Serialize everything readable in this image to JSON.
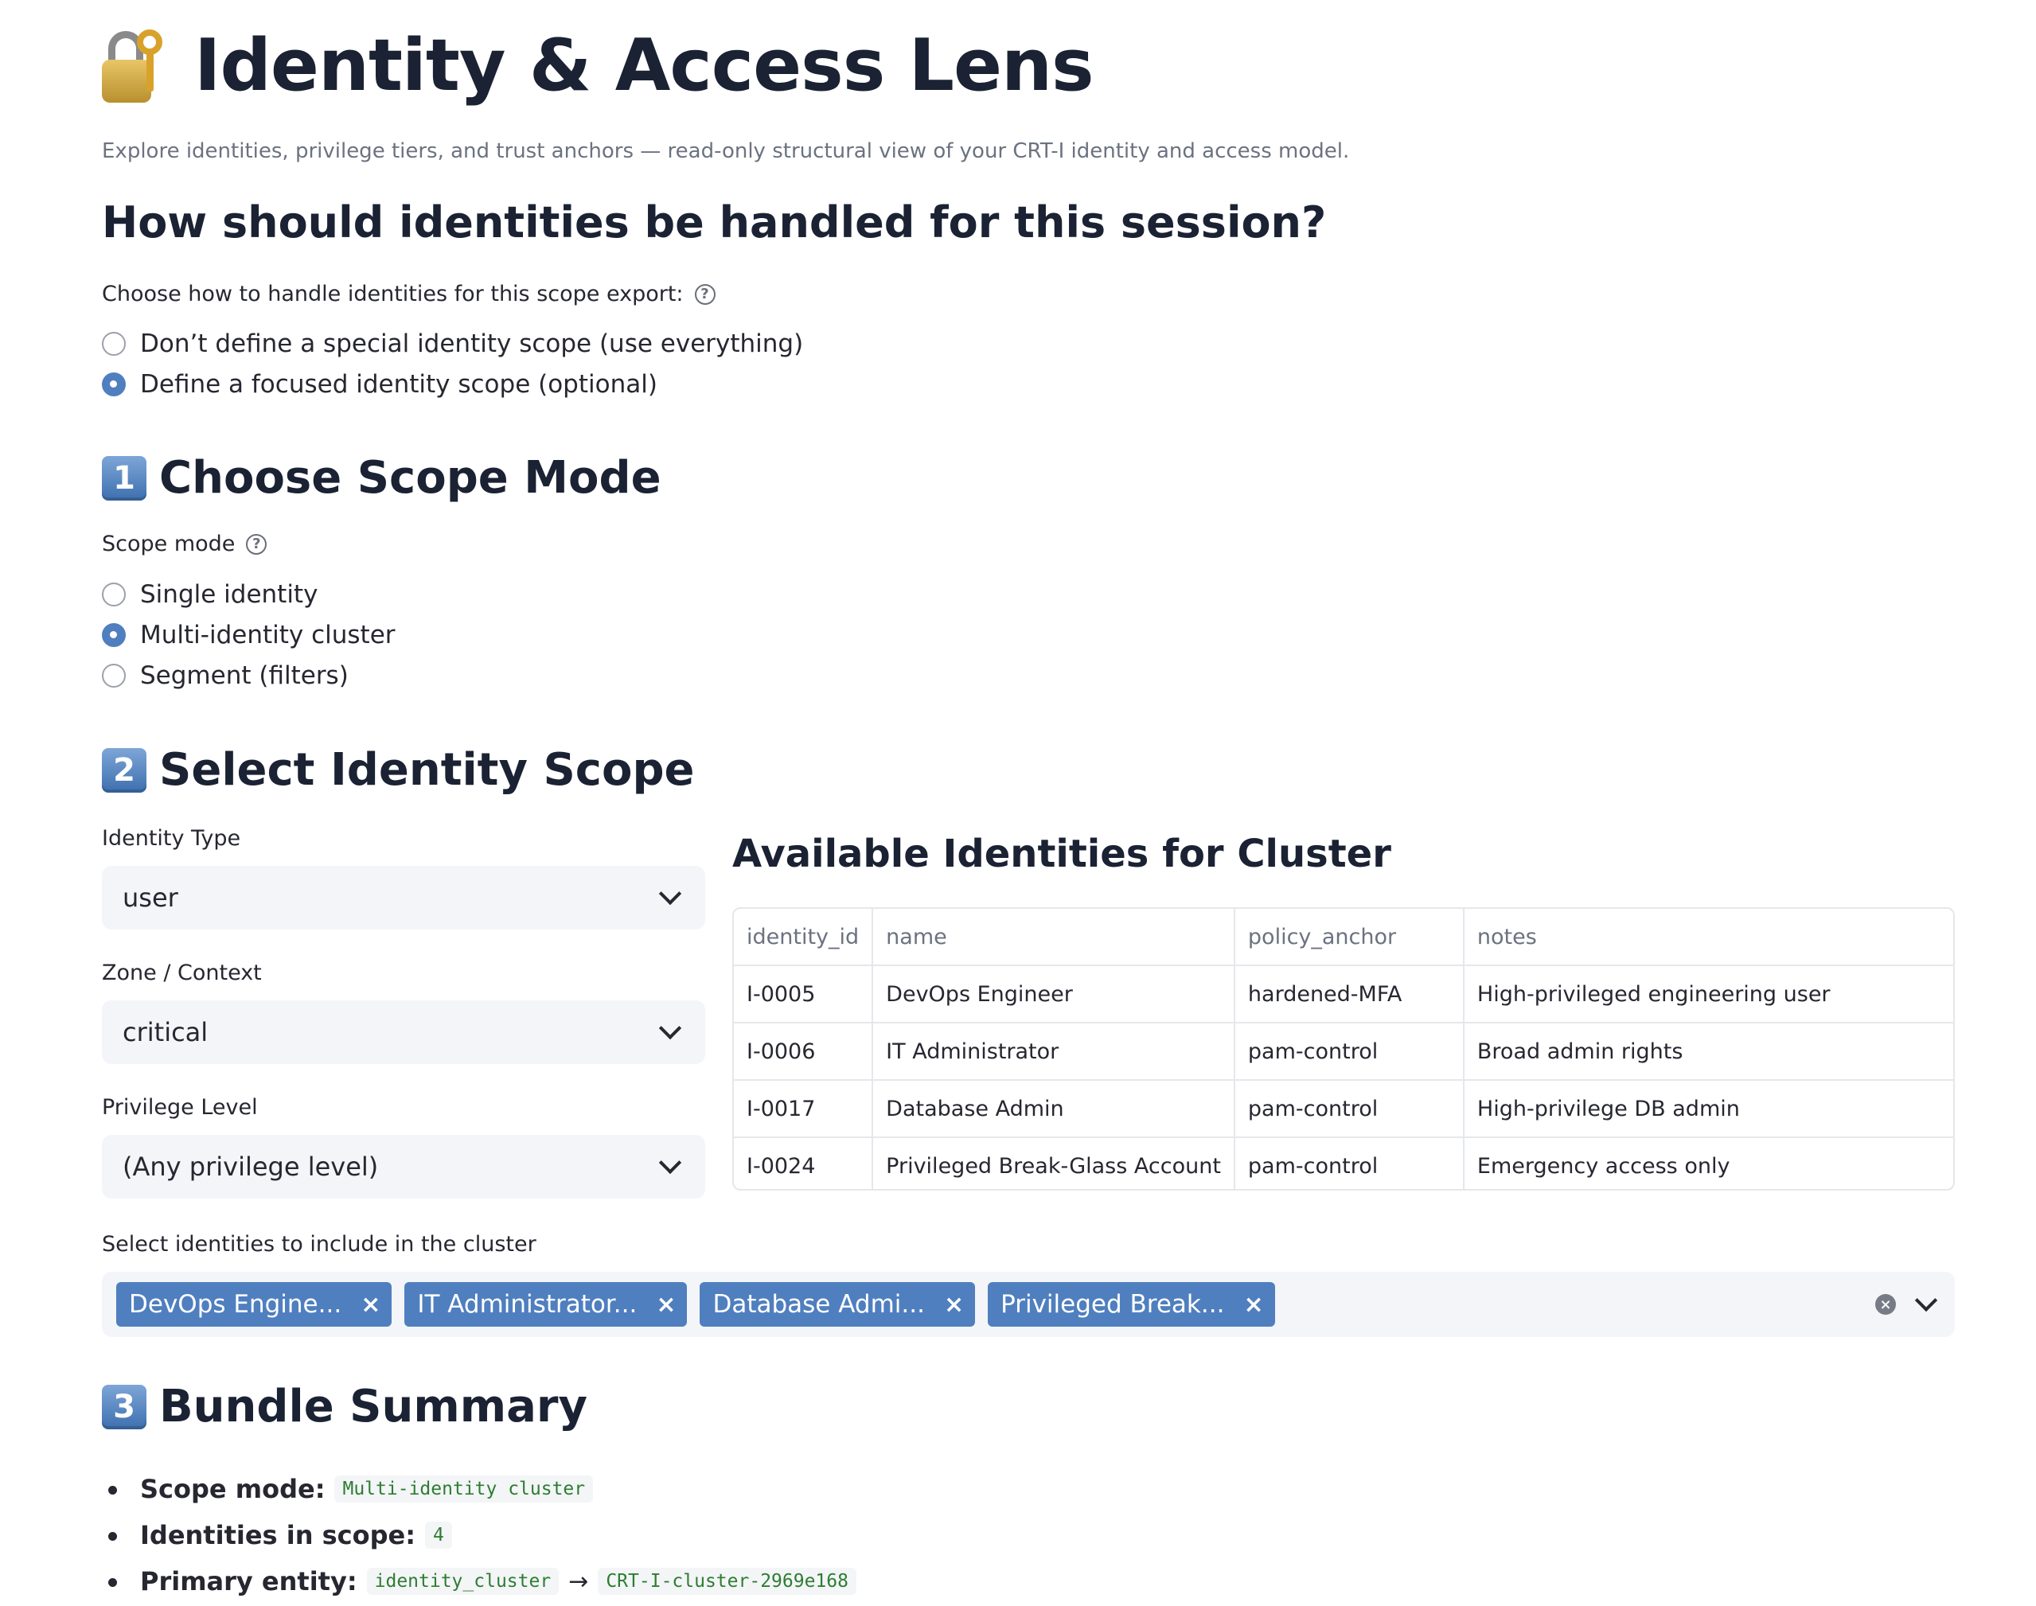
{
  "header": {
    "title": "Identity & Access Lens",
    "subtitle": "Explore identities, privilege tiers, and trust anchors — read-only structural view of your CRT-I identity and access model.",
    "icon": "lock-with-key-icon"
  },
  "identity_handling": {
    "heading": "How should identities be handled for this session?",
    "label": "Choose how to handle identities for this scope export:",
    "options": [
      {
        "label": "Don’t define a special identity scope (use everything)",
        "selected": false
      },
      {
        "label": "Define a focused identity scope (optional)",
        "selected": true
      }
    ]
  },
  "step1": {
    "number": "1",
    "title": "Choose Scope Mode",
    "label": "Scope mode",
    "options": [
      {
        "label": "Single identity",
        "selected": false
      },
      {
        "label": "Multi-identity cluster",
        "selected": true
      },
      {
        "label": "Segment (filters)",
        "selected": false
      }
    ]
  },
  "step2": {
    "number": "2",
    "title": "Select Identity Scope",
    "identity_type": {
      "label": "Identity Type",
      "value": "user"
    },
    "zone": {
      "label": "Zone / Context",
      "value": "critical"
    },
    "privilege": {
      "label": "Privilege Level",
      "value": "(Any privilege level)"
    },
    "table": {
      "title": "Available Identities for Cluster",
      "columns": [
        "identity_id",
        "name",
        "policy_anchor",
        "notes"
      ],
      "rows": [
        [
          "I-0005",
          "DevOps Engineer",
          "hardened-MFA",
          "High-privileged engineering user"
        ],
        [
          "I-0006",
          "IT Administrator",
          "pam-control",
          "Broad admin rights"
        ],
        [
          "I-0017",
          "Database Admin",
          "pam-control",
          "High-privilege DB admin"
        ],
        [
          "I-0024",
          "Privileged Break-Glass Account",
          "pam-control",
          "Emergency access only"
        ]
      ]
    },
    "cluster_select": {
      "label": "Select identities to include in the cluster",
      "tags": [
        "DevOps Engine...",
        "IT Administrator...",
        "Database Admi...",
        "Privileged Break..."
      ]
    }
  },
  "step3": {
    "number": "3",
    "title": "Bundle Summary",
    "scope_mode_label": "Scope mode:",
    "scope_mode_value": "Multi-identity cluster",
    "identities_label": "Identities in scope:",
    "identities_value": "4",
    "primary_label": "Primary entity:",
    "primary_type": "identity_cluster",
    "primary_arrow": "→",
    "primary_value": "CRT-I-cluster-2969e168"
  },
  "colors": {
    "accent": "#4f7fbf",
    "code_text": "#2e7d32",
    "input_bg": "#f3f5f9"
  }
}
